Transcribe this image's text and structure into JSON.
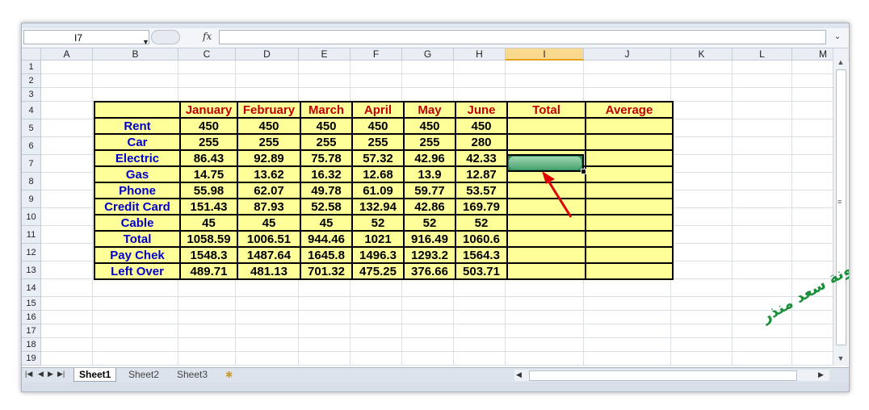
{
  "name_box": {
    "value": "I7"
  },
  "formula_bar": {
    "fx_label": "fx",
    "value": ""
  },
  "columns": [
    "A",
    "B",
    "C",
    "D",
    "E",
    "F",
    "G",
    "H",
    "I",
    "J",
    "K",
    "L",
    "M"
  ],
  "selected_column": "I",
  "rows": [
    "1",
    "2",
    "3",
    "4",
    "5",
    "6",
    "7",
    "8",
    "9",
    "10",
    "11",
    "12",
    "13",
    "14",
    "15",
    "16",
    "17",
    "18",
    "19"
  ],
  "table": {
    "headers": [
      "",
      "January",
      "February",
      "March",
      "April",
      "May",
      "June",
      "Total",
      "Average"
    ],
    "rows": [
      {
        "label": "Rent",
        "values": [
          "450",
          "450",
          "450",
          "450",
          "450",
          "450"
        ]
      },
      {
        "label": "Car",
        "values": [
          "255",
          "255",
          "255",
          "255",
          "255",
          "280"
        ]
      },
      {
        "label": "Electric",
        "values": [
          "86.43",
          "92.89",
          "75.78",
          "57.32",
          "42.96",
          "42.33"
        ]
      },
      {
        "label": "Gas",
        "values": [
          "14.75",
          "13.62",
          "16.32",
          "12.68",
          "13.9",
          "12.87"
        ]
      },
      {
        "label": "Phone",
        "values": [
          "55.98",
          "62.07",
          "49.78",
          "61.09",
          "59.77",
          "53.57"
        ]
      },
      {
        "label": "Credit Card",
        "values": [
          "151.43",
          "87.93",
          "52.58",
          "132.94",
          "42.86",
          "169.79"
        ]
      },
      {
        "label": "Cable",
        "values": [
          "45",
          "45",
          "45",
          "52",
          "52",
          "52"
        ]
      },
      {
        "label": "Total",
        "values": [
          "1058.59",
          "1006.51",
          "944.46",
          "1021",
          "916.49",
          "1060.6"
        ]
      },
      {
        "label": "Pay Chek",
        "values": [
          "1548.3",
          "1487.64",
          "1645.8",
          "1496.3",
          "1293.2",
          "1564.3"
        ]
      },
      {
        "label": "Left Over",
        "values": [
          "489.71",
          "481.13",
          "701.32",
          "475.25",
          "376.66",
          "503.71"
        ]
      }
    ]
  },
  "sheet_tabs": [
    "Sheet1",
    "Sheet2",
    "Sheet3"
  ],
  "active_sheet": "Sheet1",
  "watermark": "مدونة سعد منذر",
  "colors": {
    "header_text": "#c00000",
    "label_text": "#0000cc",
    "cell_fill": "#ffff99",
    "selection": "#2e8b57",
    "arrow": "#e00000"
  }
}
